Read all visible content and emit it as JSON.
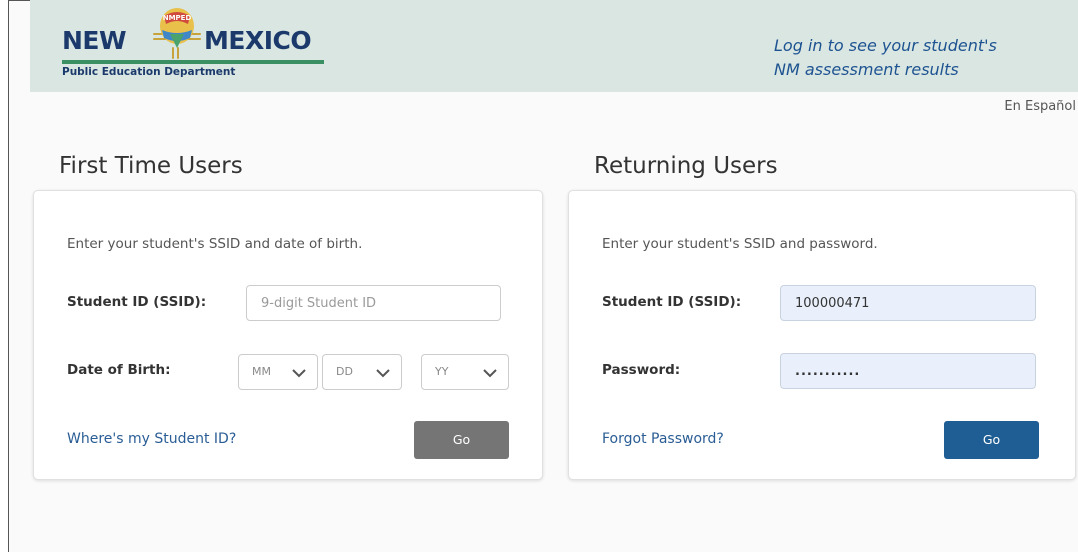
{
  "header": {
    "logo": {
      "word_left": "NEW",
      "word_right": "MEXICO",
      "subtitle": "Public Education Department",
      "balloon_text": "NMPED"
    },
    "tagline_line1": "Log in to see your student's",
    "tagline_line2": "NM assessment results",
    "language_link": "En Español"
  },
  "first_time": {
    "title": "First Time Users",
    "instructions": "Enter your student's SSID and date of birth.",
    "ssid_label": "Student ID (SSID):",
    "ssid_placeholder": "9-digit Student ID",
    "ssid_value": "",
    "dob_label": "Date of Birth:",
    "month_select": "MM",
    "day_select": "DD",
    "year_select": "YY",
    "help_link": "Where's my Student ID?",
    "go_label": "Go"
  },
  "returning": {
    "title": "Returning Users",
    "instructions": "Enter your student's SSID and password.",
    "ssid_label": "Student ID (SSID):",
    "ssid_value": "100000471",
    "password_label": "Password:",
    "password_value": "...........",
    "forgot_link": "Forgot Password?",
    "go_label": "Go"
  },
  "colors": {
    "banner": "#d9e6e2",
    "brand_navy": "#1b3a6b",
    "brand_green": "#3a8f63",
    "link_blue": "#2a5d95",
    "go_blue": "#1f5e94",
    "go_grey": "#757575",
    "autofill_bg": "#e9f0fb"
  },
  "icons": {
    "logo": "zia-sun-balloon-icon",
    "select_arrow": "chevron-down-icon"
  }
}
